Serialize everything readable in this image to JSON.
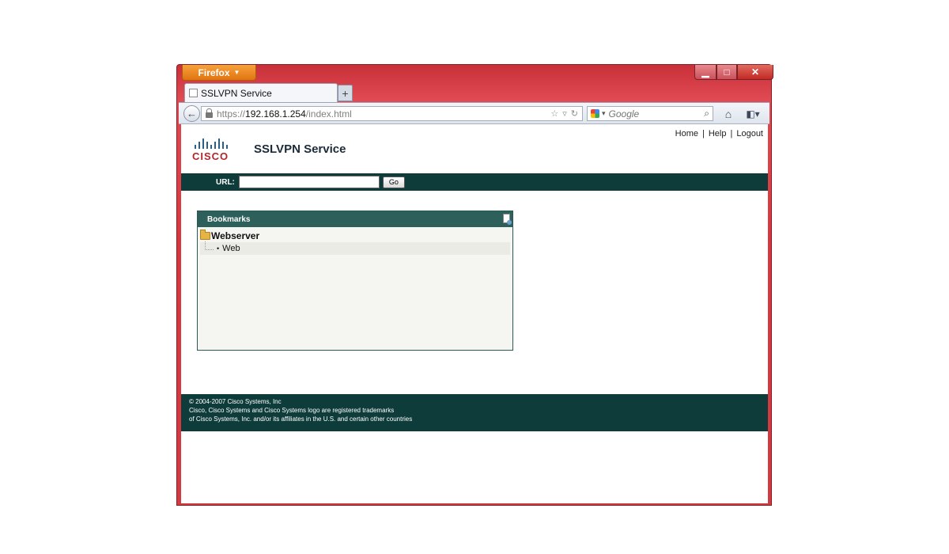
{
  "browser": {
    "app_button": "Firefox",
    "tab_title": "SSLVPN Service",
    "new_tab": "+",
    "address": {
      "scheme": "https://",
      "host": "192.168.1.254",
      "path": "/index.html"
    },
    "search_placeholder": "Google"
  },
  "page": {
    "top_links": [
      "Home",
      "Help",
      "Logout"
    ],
    "logo_text": "CISCO",
    "title": "SSLVPN Service",
    "url_label": "URL:",
    "url_value": "",
    "go_button": "Go",
    "bookmarks": {
      "header": "Bookmarks",
      "folder": "Webserver",
      "items": [
        "Web"
      ]
    },
    "footer": {
      "line1": "© 2004-2007 Cisco Systems, Inc",
      "line2": "Cisco, Cisco Systems and Cisco Systems logo are registered trademarks",
      "line3": "of Cisco Systems, Inc. and/or its affiliates in the U.S. and certain other countries"
    }
  },
  "colors": {
    "accent_bar": "#0e3c3a",
    "bookmark_header": "#2d5f5b",
    "window_frame": "#d23a42",
    "cisco_red": "#b3262b"
  }
}
